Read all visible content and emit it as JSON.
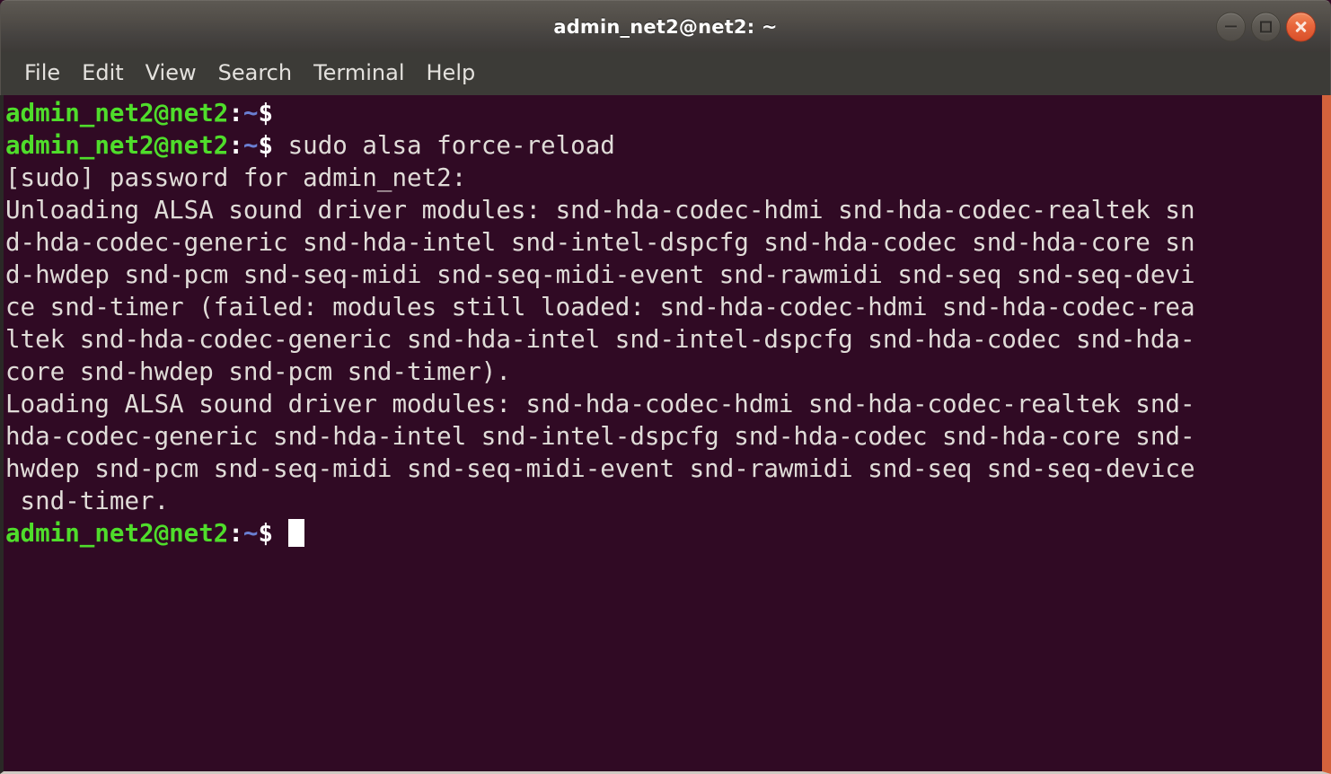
{
  "window": {
    "title": "admin_net2@net2: ~",
    "controls": [
      {
        "name": "minimize",
        "label": "–"
      },
      {
        "name": "maximize",
        "label": "□"
      },
      {
        "name": "close",
        "label": "×"
      }
    ]
  },
  "menu": {
    "items": [
      "File",
      "Edit",
      "View",
      "Search",
      "Terminal",
      "Help"
    ]
  },
  "colors": {
    "terminal_background": "#300a24",
    "terminal_foreground": "#e8e4e0",
    "prompt_user_host": "#4fdd2b",
    "prompt_path_tilde": "#6a7fd2",
    "prompt_symbol": "#ffffff",
    "titlebar_top": "#5d5953",
    "titlebar_bottom": "#3d3a37",
    "menubar_background": "#3c3b37",
    "window_accent_border": "#d3623c",
    "close_button": "#e8663b",
    "cursor": "#ffffff"
  },
  "terminal": {
    "prompt": {
      "user_host": "admin_net2@net2",
      "colon": ":",
      "tilde": "~",
      "symbol": "$"
    },
    "command": "sudo alsa force-reload",
    "cursor_visible": true,
    "lines": [
      {
        "type": "prompt",
        "command": ""
      },
      {
        "type": "prompt",
        "command": " sudo alsa force-reload"
      },
      {
        "type": "output",
        "text": "[sudo] password for admin_net2:"
      },
      {
        "type": "output",
        "text": "Unloading ALSA sound driver modules: snd-hda-codec-hdmi snd-hda-codec-realtek sn"
      },
      {
        "type": "output",
        "text": "d-hda-codec-generic snd-hda-intel snd-intel-dspcfg snd-hda-codec snd-hda-core sn"
      },
      {
        "type": "output",
        "text": "d-hwdep snd-pcm snd-seq-midi snd-seq-midi-event snd-rawmidi snd-seq snd-seq-devi"
      },
      {
        "type": "output",
        "text": "ce snd-timer (failed: modules still loaded: snd-hda-codec-hdmi snd-hda-codec-rea"
      },
      {
        "type": "output",
        "text": "ltek snd-hda-codec-generic snd-hda-intel snd-intel-dspcfg snd-hda-codec snd-hda-"
      },
      {
        "type": "output",
        "text": "core snd-hwdep snd-pcm snd-timer)."
      },
      {
        "type": "output",
        "text": "Loading ALSA sound driver modules: snd-hda-codec-hdmi snd-hda-codec-realtek snd-"
      },
      {
        "type": "output",
        "text": "hda-codec-generic snd-hda-intel snd-intel-dspcfg snd-hda-codec snd-hda-core snd-"
      },
      {
        "type": "output",
        "text": "hwdep snd-pcm snd-seq-midi snd-seq-midi-event snd-rawmidi snd-seq snd-seq-device"
      },
      {
        "type": "output",
        "text": " snd-timer."
      },
      {
        "type": "prompt",
        "command": " ",
        "cursor": true
      }
    ]
  }
}
